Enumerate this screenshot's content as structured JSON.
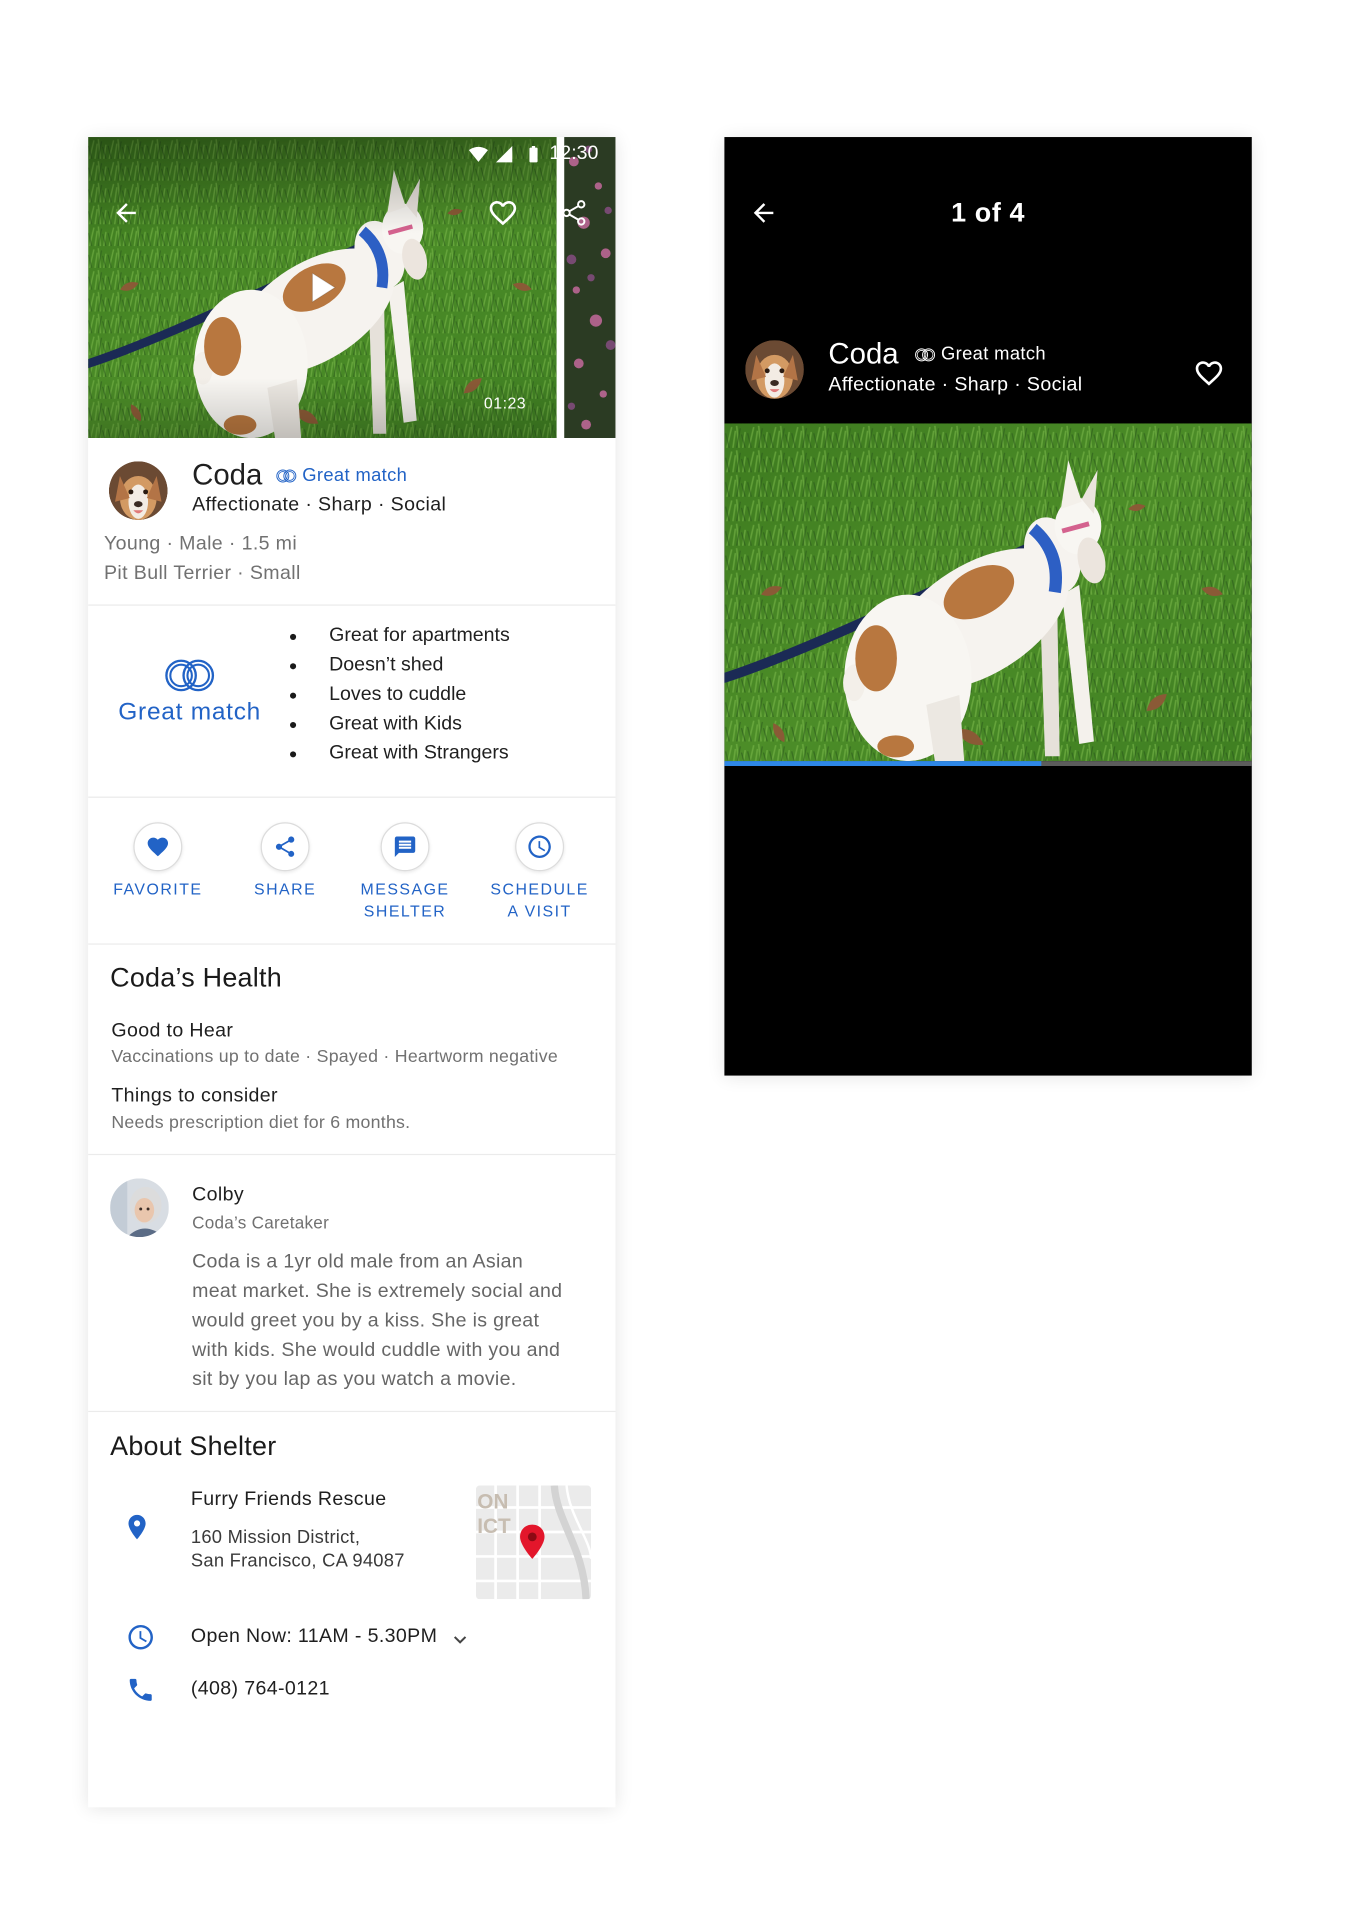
{
  "colors": {
    "accent": "#2263c6",
    "progress": "#2e87e6",
    "map_pin": "#e3162b",
    "profile_background": "#ffffff",
    "viewer_background": "#000000"
  },
  "profile_screen": {
    "status_bar": {
      "time": "12:30",
      "icons": [
        "wifi-icon",
        "signal-icon",
        "battery-icon"
      ]
    },
    "hero": {
      "duration": "01:23",
      "icons": [
        "back-arrow-icon",
        "heart-outline-icon",
        "share-icon",
        "play-icon"
      ]
    },
    "pet": {
      "name": "Coda",
      "match_label": "Great match",
      "traits": "Affectionate · Sharp · Social",
      "details": [
        "Young · Male · 1.5 mi",
        "Pit Bull Terrier · Small"
      ]
    },
    "match": {
      "label": "Great match",
      "highlights": [
        "Great for apartments",
        "Doesn’t shed",
        "Loves to cuddle",
        "Great with Kids",
        "Great with Strangers"
      ]
    },
    "actions": [
      {
        "icon": "heart-icon",
        "label": "FAVORITE"
      },
      {
        "icon": "share-icon",
        "label": "SHARE"
      },
      {
        "icon": "message-icon",
        "label": "MESSAGE\nSHELTER"
      },
      {
        "icon": "clock-icon",
        "label": "SCHEDULE\nA VISIT"
      }
    ],
    "health": {
      "title": "Coda’s Health",
      "good_heading": "Good to Hear",
      "good_text": "Vaccinations up to date · Spayed · Heartworm negative",
      "consider_heading": "Things to consider",
      "consider_text": "Needs prescription diet for 6 months."
    },
    "caretaker": {
      "name": "Colby",
      "role": "Coda’s Caretaker",
      "bio": "Coda is a 1yr old male from an Asian\nmeat market. She is extremely social and\nwould greet you by a kiss. She is great\nwith kids. She would cuddle with you and\nsit by you lap as you watch a movie."
    },
    "shelter": {
      "title": "About Shelter",
      "name": "Furry Friends Rescue",
      "address": [
        "160 Mission District,",
        "San Francisco, CA 94087"
      ],
      "map_labels": [
        "ON",
        "ICT"
      ],
      "hours": "Open Now: 11AM - 5.30PM",
      "phone": "(408) 764-0121"
    }
  },
  "viewer_screen": {
    "counter": "1 of 4",
    "pet": {
      "name": "Coda",
      "match_label": "Great match",
      "traits": "Affectionate · Sharp · Social"
    },
    "progress": 0.6
  }
}
